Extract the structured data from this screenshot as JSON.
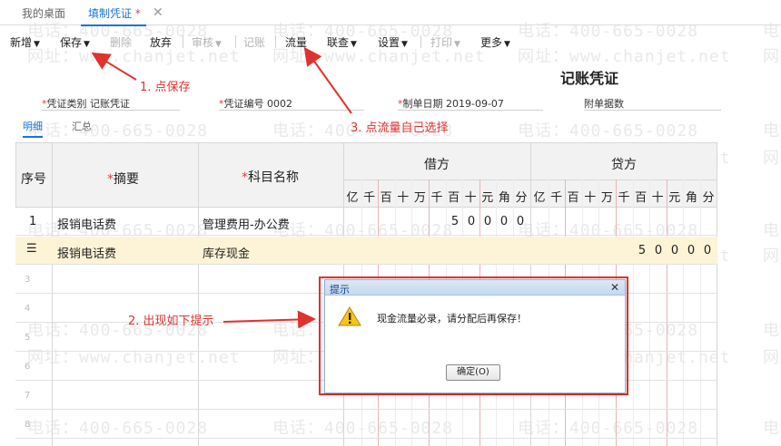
{
  "watermark": {
    "phone": "电话：400-665-0028",
    "site": "网址：www.chanjet.net"
  },
  "tabs": {
    "home": "我的桌面",
    "active": "填制凭证",
    "active_marker": "*",
    "close": "✕"
  },
  "toolbar": {
    "new": "新增",
    "save": "保存",
    "delete": "删除",
    "discard": "放弃",
    "audit": "审核",
    "post": "记账",
    "cashflow": "流量",
    "linkquery": "联查",
    "settings": "设置",
    "print": "打印",
    "more": "更多"
  },
  "annotations": {
    "step1": "1. 点保存",
    "step2": "2. 出现如下提示",
    "step3": "3. 点流量自己选择",
    "color": "#e0322e"
  },
  "voucher": {
    "title": "记账凭证",
    "type_label": "凭证类别",
    "type_value": "记账凭证",
    "number_label": "凭证编号",
    "number_value": "0002",
    "date_label": "制单日期",
    "date_value": "2019-09-07",
    "attachments_label": "附单据数"
  },
  "subtabs": {
    "detail": "明细",
    "summary": "汇总"
  },
  "grid": {
    "col_seq": "序号",
    "col_summary": "摘要",
    "col_account": "科目名称",
    "col_debit": "借方",
    "col_credit": "贷方",
    "units": [
      "亿",
      "千",
      "百",
      "十",
      "万",
      "千",
      "百",
      "十",
      "元",
      "角",
      "分"
    ],
    "rows": [
      {
        "seq": "1",
        "summary": "报销电话费",
        "account": "管理费用-办公费",
        "debit": [
          "5",
          "0",
          "0",
          "0",
          "0"
        ],
        "credit": []
      },
      {
        "seq": "",
        "summary": "报销电话费",
        "account": "库存现金",
        "debit": [],
        "credit": [
          "5",
          "0",
          "0",
          "0",
          "0"
        ]
      },
      {
        "seq": "3"
      },
      {
        "seq": "4"
      },
      {
        "seq": "5"
      },
      {
        "seq": "6"
      },
      {
        "seq": "7"
      },
      {
        "seq": "8"
      }
    ]
  },
  "dialog": {
    "title": "提示",
    "close": "✕",
    "message": "现金流量必录，请分配后再保存！",
    "ok": "确定(O)"
  }
}
